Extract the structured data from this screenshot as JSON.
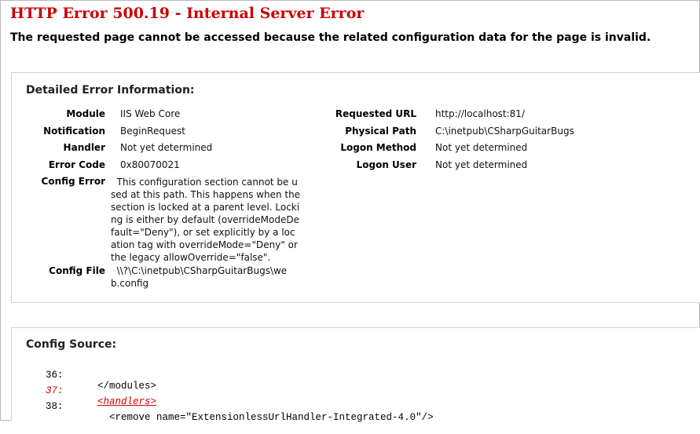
{
  "page": {
    "title": "HTTP Error 500.19 - Internal Server Error",
    "subtitle": "The requested page cannot be accessed because the related configuration data for the page is invalid."
  },
  "details": {
    "heading": "Detailed Error Information:",
    "left": [
      {
        "label": "Module",
        "value": "IIS Web Core"
      },
      {
        "label": "Notification",
        "value": "BeginRequest"
      },
      {
        "label": "Handler",
        "value": "Not yet determined"
      },
      {
        "label": "Error Code",
        "value": "0x80070021"
      },
      {
        "label": "Config Error",
        "value": "  This configuration section cannot be u\nsed at this path. This happens when the\nsection is locked at a parent level. Locki\nng is either by default (overrideModeDe\nfault=\"Deny\"), or set explicitly by a loc\nation tag with overrideMode=\"Deny\" or\nthe legacy allowOverride=\"false\"."
      },
      {
        "label": "Config File",
        "value": "  \\\\?\\C:\\inetpub\\CSharpGuitarBugs\\we\nb.config"
      }
    ],
    "right": [
      {
        "label": "Requested URL",
        "value": "http://localhost:81/"
      },
      {
        "label": "Physical Path",
        "value": "C:\\inetpub\\CSharpGuitarBugs"
      },
      {
        "label": "Logon Method",
        "value": "Not yet determined"
      },
      {
        "label": "Logon User",
        "value": "Not yet determined"
      }
    ]
  },
  "config_source": {
    "heading": "Config Source:",
    "lines": [
      {
        "num": "36:",
        "text": "</modules>",
        "highlight": false
      },
      {
        "num": "37:",
        "text": "<handlers>",
        "highlight": true
      },
      {
        "num": "38:",
        "text": "  <remove name=\"ExtensionlessUrlHandler-Integrated-4.0\"/>",
        "highlight": false
      }
    ]
  },
  "colors": {
    "title": "#cc0000",
    "highlight_line": "#cc0000",
    "panel_border": "#d2d2d2"
  }
}
